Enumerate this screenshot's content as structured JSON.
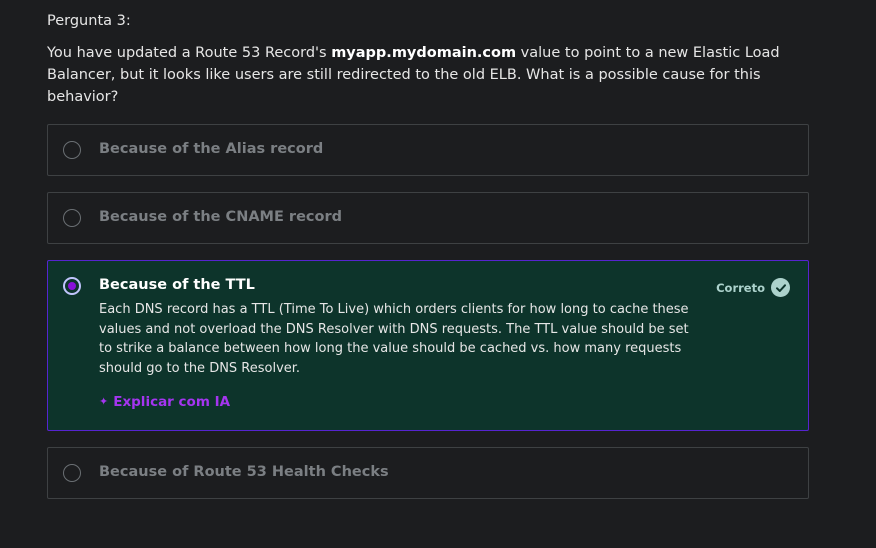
{
  "question": {
    "number_label": "Pergunta 3:",
    "text_before": "You have updated a Route 53 Record's ",
    "text_bold": "myapp.mydomain.com",
    "text_after": " value to point to a new Elastic Load Balancer, but it looks like users are still redirected to the old ELB. What is a possible cause for this behavior?"
  },
  "options": [
    {
      "label": "Because of the Alias record",
      "selected": false
    },
    {
      "label": "Because of the CNAME record",
      "selected": false
    },
    {
      "label": "Because of the TTL",
      "selected": true,
      "status": "Correto",
      "explanation": "Each DNS record has a TTL (Time To Live) which orders clients for how long to cache these values and not overload the DNS Resolver with DNS requests. The TTL value should be set to strike a balance between how long the value should be cached vs. how many requests should go to the DNS Resolver.",
      "ai_link": "Explicar com IA"
    },
    {
      "label": "Because of Route 53 Health Checks",
      "selected": false
    }
  ],
  "colors": {
    "background": "#1c1d1f",
    "correct_background": "#0d342b",
    "selected_border": "#5624d0",
    "correct_badge": "#acd2cc",
    "ai_link": "#a435f0"
  },
  "icons": {
    "correct": "check-circle-icon",
    "ai": "sparkle-icon"
  }
}
